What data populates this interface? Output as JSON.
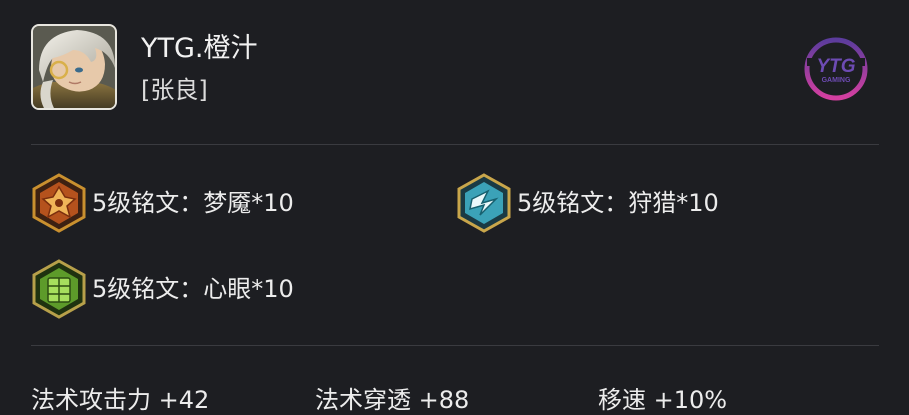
{
  "header": {
    "player_name": "YTG.橙汁",
    "hero_name": "[张良]",
    "avatar_icon": "hero-portrait-avatar",
    "logo_icon": "ytg-gaming-logo",
    "logo_text": "YTG",
    "logo_subtext": "GAMING"
  },
  "runes": [
    {
      "label": "5级铭文：梦魇*10",
      "icon": "red-rune-icon",
      "color": "#b5521d"
    },
    {
      "label": "5级铭文：狩猎*10",
      "icon": "blue-rune-icon",
      "color": "#3ba2b8"
    },
    {
      "label": "5级铭文：心眼*10",
      "icon": "green-rune-icon",
      "color": "#5d9b2a"
    }
  ],
  "attributes": [
    {
      "label": "法术攻击力 +42"
    },
    {
      "label": "法术穿透 +88"
    },
    {
      "label": "移速 +10%"
    }
  ],
  "colors": {
    "background": "#1d1e22",
    "divider": "#3a3b40",
    "text": "#ececec",
    "logo_purple": "#5c3c9d",
    "logo_magenta": "#d43fa0"
  }
}
